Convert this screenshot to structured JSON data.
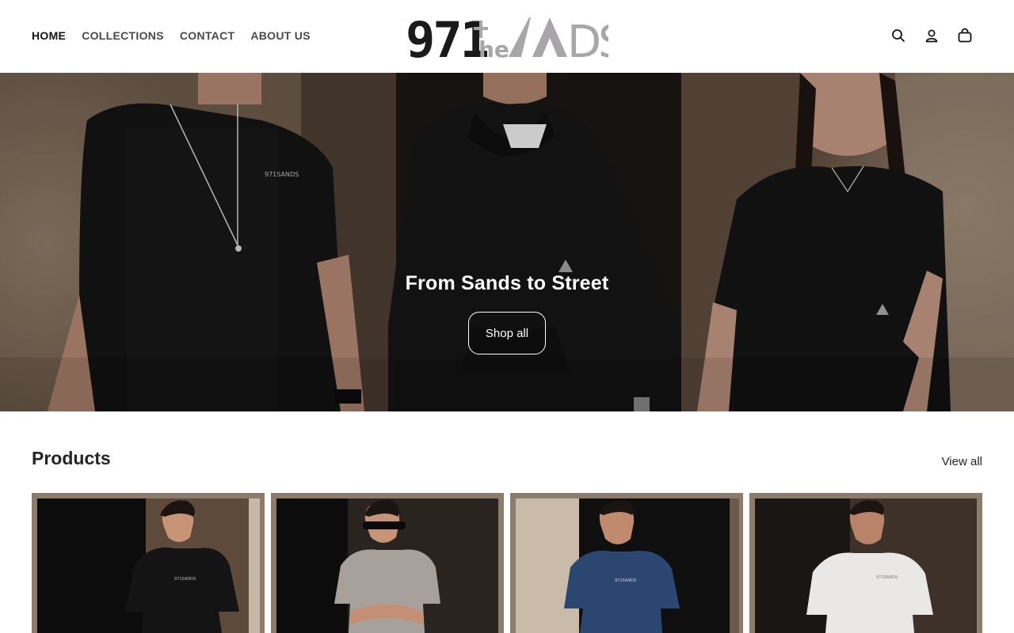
{
  "header": {
    "nav": [
      {
        "label": "HOME",
        "active": true
      },
      {
        "label": "COLLECTIONS",
        "active": false
      },
      {
        "label": "CONTACT",
        "active": false
      },
      {
        "label": "ABOUT US",
        "active": false
      }
    ],
    "logo": {
      "number": "971",
      "word_top": "the",
      "word_bottom": "SANDS"
    },
    "icons": [
      "search-icon",
      "account-icon",
      "cart-icon"
    ]
  },
  "hero": {
    "title": "From Sands to Street",
    "button_label": "Shop all"
  },
  "products": {
    "title": "Products",
    "view_all_label": "View all",
    "items": [
      {
        "shirt_color": "#141414"
      },
      {
        "shirt_color": "#a7a09b"
      },
      {
        "shirt_color": "#2b4670"
      },
      {
        "shirt_color": "#e9e8e6"
      }
    ]
  },
  "colors": {
    "text": "#121212",
    "nav_text": "#4a4a4a",
    "logo_dark": "#1a1a1a",
    "logo_gray": "#a8a6a8"
  }
}
